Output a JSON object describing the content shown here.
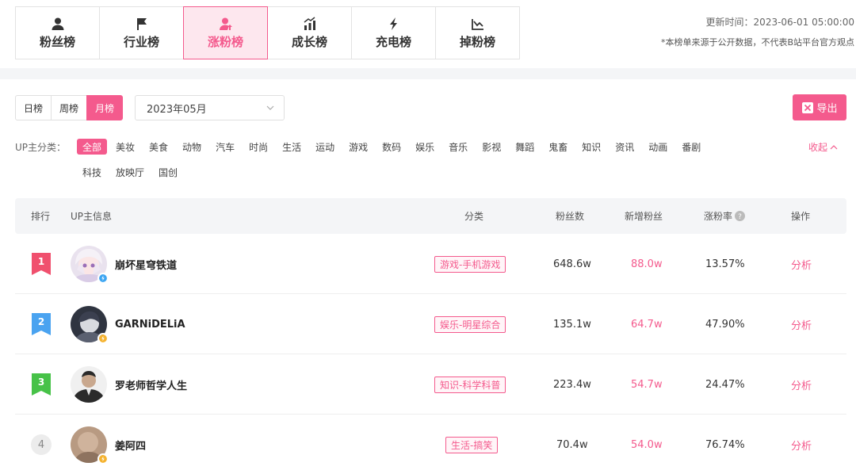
{
  "tabs": [
    {
      "label": "粉丝榜",
      "icon": "user-icon",
      "active": false
    },
    {
      "label": "行业榜",
      "icon": "flag-icon",
      "active": false
    },
    {
      "label": "涨粉榜",
      "icon": "user-up-icon",
      "active": true
    },
    {
      "label": "成长榜",
      "icon": "growth-bars-icon",
      "active": false
    },
    {
      "label": "充电榜",
      "icon": "lightning-icon",
      "active": false
    },
    {
      "label": "掉粉榜",
      "icon": "decline-chart-icon",
      "active": false
    }
  ],
  "header": {
    "update_time": "更新时间：2023-06-01 05:00:00",
    "note": "*本榜单来源于公开数据，不代表B站平台官方观点"
  },
  "periods": [
    {
      "label": "日榜",
      "active": false
    },
    {
      "label": "周榜",
      "active": false
    },
    {
      "label": "月榜",
      "active": true
    }
  ],
  "month_select": {
    "value": "2023年05月",
    "icon": "chevron-down-icon"
  },
  "export": {
    "label": "导出",
    "icon": "excel-icon"
  },
  "categories": {
    "label": "UP主分类：",
    "row1": [
      "全部",
      "美妆",
      "美食",
      "动物",
      "汽车",
      "时尚",
      "生活",
      "运动",
      "游戏",
      "数码",
      "娱乐",
      "音乐",
      "影视",
      "舞蹈",
      "鬼畜",
      "知识",
      "资讯",
      "动画",
      "番剧"
    ],
    "row2": [
      "科技",
      "放映厅",
      "国创"
    ],
    "active": "全部",
    "collapse_label": "收起"
  },
  "table": {
    "headers": {
      "rank": "排行",
      "info": "UP主信息",
      "category": "分类",
      "fans": "粉丝数",
      "new_fans": "新增粉丝",
      "rate": "涨粉率",
      "action": "操作"
    },
    "rows": [
      {
        "rank": "1",
        "name": "崩坏星穹铁道",
        "category": "游戏-手机游戏",
        "fans": "648.6w",
        "new_fans": "88.0w",
        "rate": "13.57%",
        "action": "分析"
      },
      {
        "rank": "2",
        "name": "GARNiDELiA",
        "category": "娱乐-明星综合",
        "fans": "135.1w",
        "new_fans": "64.7w",
        "rate": "47.90%",
        "action": "分析"
      },
      {
        "rank": "3",
        "name": "罗老师哲学人生",
        "category": "知识-科学科普",
        "fans": "223.4w",
        "new_fans": "54.7w",
        "rate": "24.47%",
        "action": "分析"
      },
      {
        "rank": "4",
        "name": "姜阿四",
        "category": "生活-搞笑",
        "fans": "70.4w",
        "new_fans": "54.0w",
        "rate": "76.74%",
        "action": "分析"
      }
    ]
  },
  "colors": {
    "accent": "#f45a8d",
    "rank1": "#f0506e",
    "rank2": "#4aa3f0",
    "rank3": "#47c248"
  }
}
